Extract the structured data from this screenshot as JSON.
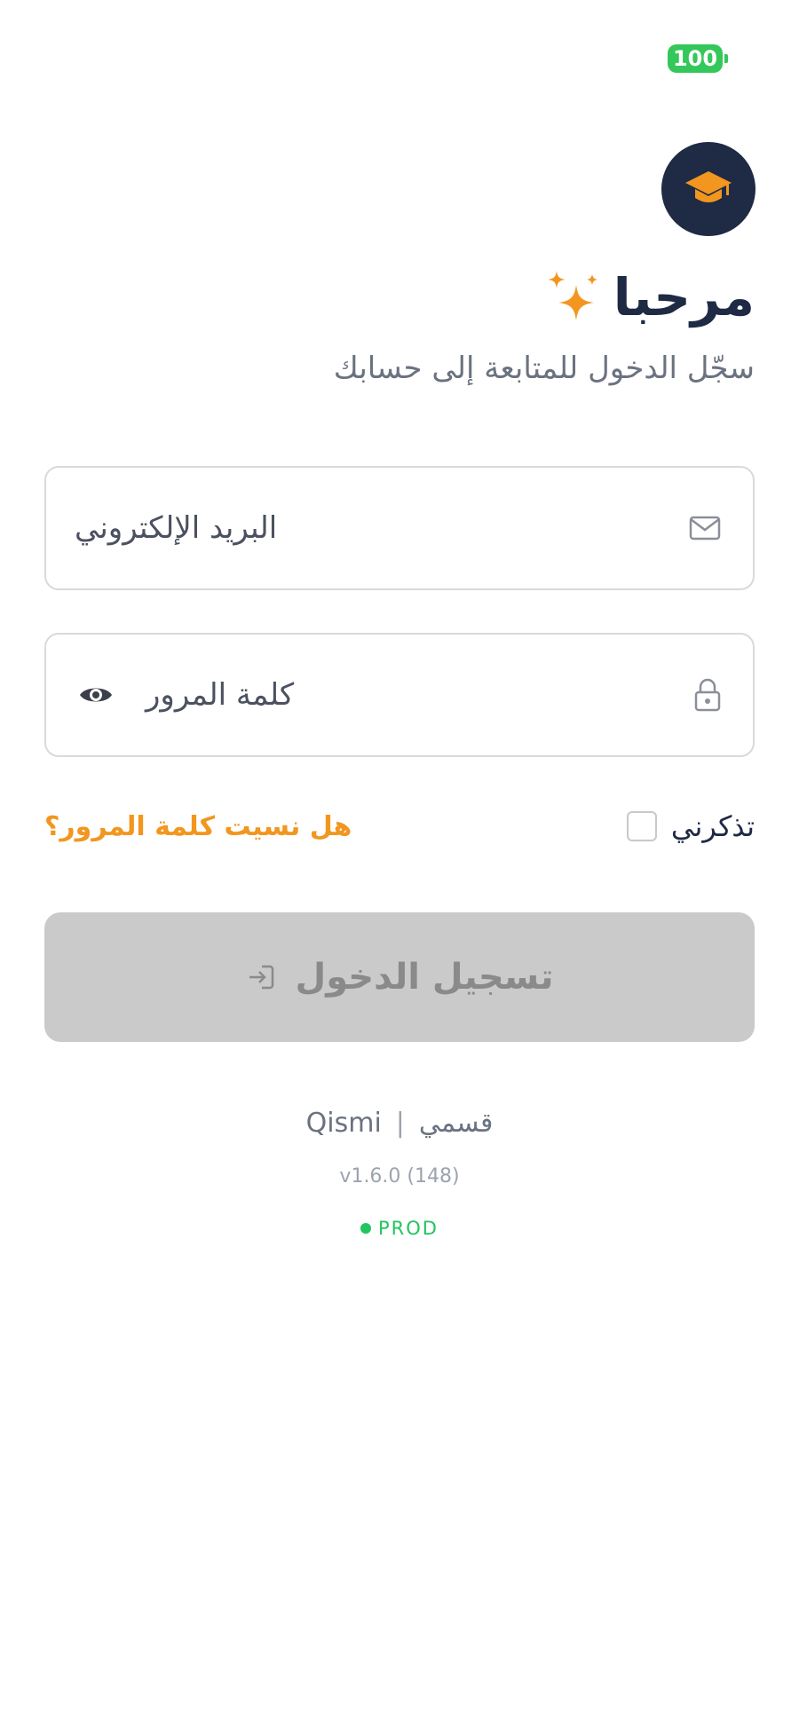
{
  "status_bar": {
    "battery": "100"
  },
  "header": {
    "title": "مرحبا",
    "subtitle": "سجّل الدخول للمتابعة إلى حسابك"
  },
  "form": {
    "email_placeholder": "البريد الإلكتروني",
    "password_placeholder": "كلمة المرور",
    "remember_label": "تذكرني",
    "forgot_link": "هل نسيت كلمة المرور؟",
    "login_label": "تسجيل الدخول"
  },
  "footer": {
    "brand_ar": "قسمي",
    "brand_sep": "|",
    "brand_en": "Qismi",
    "version": "v1.6.0 (148)",
    "environment": "PROD"
  },
  "colors": {
    "navy": "#1f2a44",
    "accent_orange": "#f2961f",
    "button_disabled": "#cacaca",
    "env_green": "#22c55e"
  },
  "icons": {
    "logo": "graduation-cap-icon",
    "title": "sparkles-icon",
    "email": "mail-icon",
    "password": "lock-icon",
    "toggle": "eye-icon",
    "login": "login-arrow-icon"
  }
}
